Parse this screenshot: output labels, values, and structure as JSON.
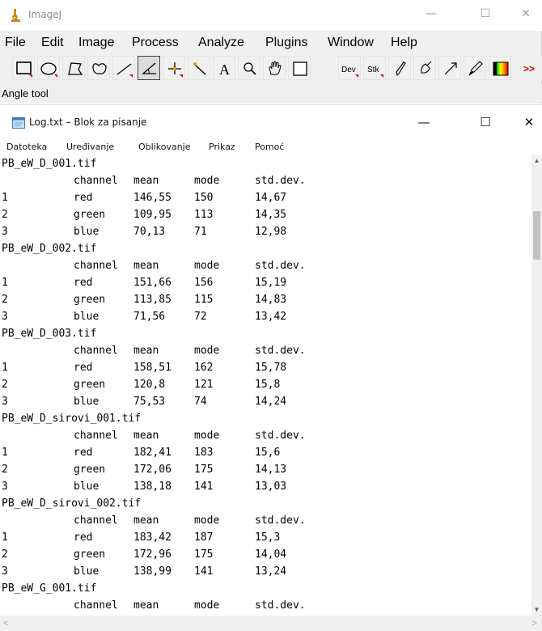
{
  "imagej": {
    "title": "ImageJ",
    "menu": [
      "File",
      "Edit",
      "Image",
      "Process",
      "Analyze",
      "Plugins",
      "Window",
      "Help"
    ],
    "status": "Angle tool",
    "tools": [
      "rectangle-tool",
      "oval-tool",
      "polygon-tool",
      "freehand-tool",
      "line-tool",
      "angle-tool",
      "point-tool",
      "wand-tool",
      "text-tool",
      "magnifier-tool",
      "hand-tool",
      "color-picker-tool",
      "dev-menu",
      "stk-menu",
      "pencil-tool",
      "brush-tool",
      "arrow-tool",
      "flood-fill-tool",
      "lut-menu",
      "more-tools"
    ],
    "tool_labels": {
      "dev": "Dev",
      "stk": "Stk",
      "text": "A",
      "more": ">>"
    },
    "window_buttons": {
      "minimize": "—",
      "maximize": "☐",
      "close": "✕"
    }
  },
  "notepad": {
    "title": "Log.txt – Blok za pisanje",
    "menu": [
      "Datoteka",
      "Uređivanje",
      "Oblikovanje",
      "Prikaz",
      "Pomoć"
    ],
    "window_buttons": {
      "minimize": "—",
      "maximize": "☐",
      "close": "✕"
    },
    "header": [
      "",
      "channel",
      "mean",
      "mode",
      "std.dev."
    ],
    "blocks": [
      {
        "file": "PB_eW_D_001.tif",
        "rows": [
          [
            "1",
            "red",
            "146,55",
            "150",
            "14,67"
          ],
          [
            "2",
            "green",
            "109,95",
            "113",
            "14,35"
          ],
          [
            "3",
            "blue",
            "70,13",
            "71",
            "12,98"
          ]
        ]
      },
      {
        "file": "PB_eW_D_002.tif",
        "rows": [
          [
            "1",
            "red",
            "151,66",
            "156",
            "15,19"
          ],
          [
            "2",
            "green",
            "113,85",
            "115",
            "14,83"
          ],
          [
            "3",
            "blue",
            "71,56",
            "72",
            "13,42"
          ]
        ]
      },
      {
        "file": "PB_eW_D_003.tif",
        "rows": [
          [
            "1",
            "red",
            "158,51",
            "162",
            "15,78"
          ],
          [
            "2",
            "green",
            "120,8",
            "121",
            "15,8"
          ],
          [
            "3",
            "blue",
            "75,53",
            "74",
            "14,24"
          ]
        ]
      },
      {
        "file": "PB_eW_D_sirovi_001.tif",
        "rows": [
          [
            "1",
            "red",
            "182,41",
            "183",
            "15,6"
          ],
          [
            "2",
            "green",
            "172,06",
            "175",
            "14,13"
          ],
          [
            "3",
            "blue",
            "138,18",
            "141",
            "13,03"
          ]
        ]
      },
      {
        "file": "PB_eW_D_sirovi_002.tif",
        "rows": [
          [
            "1",
            "red",
            "183,42",
            "187",
            "15,3"
          ],
          [
            "2",
            "green",
            "172,96",
            "175",
            "14,04"
          ],
          [
            "3",
            "blue",
            "138,99",
            "141",
            "13,24"
          ]
        ]
      },
      {
        "file": "PB_eW_G_001.tif",
        "rows": []
      }
    ]
  }
}
